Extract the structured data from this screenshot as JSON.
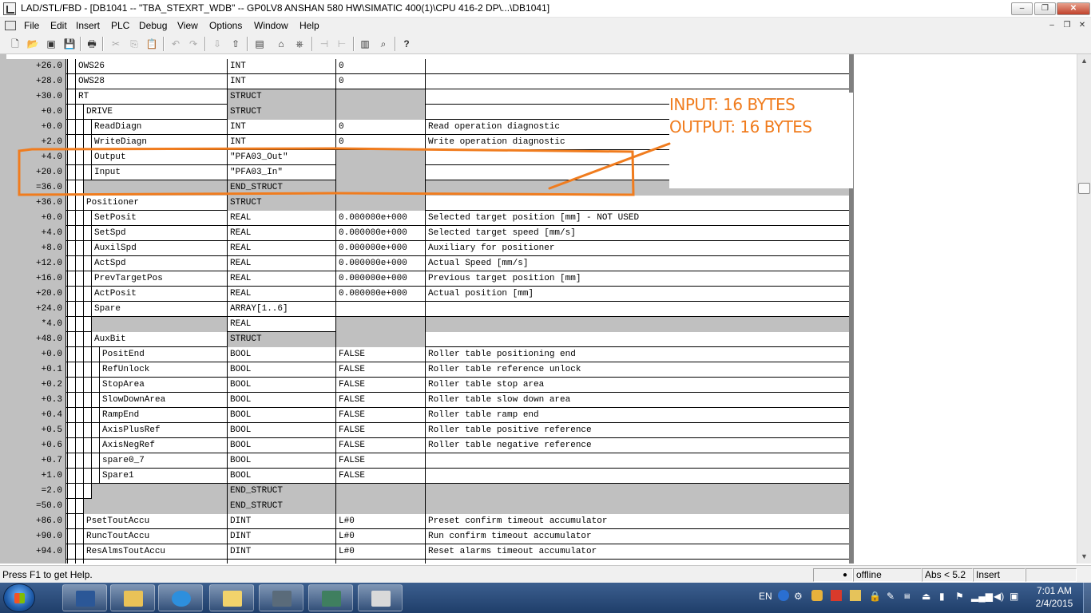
{
  "window": {
    "title": "LAD/STL/FBD  - [DB1041 -- \"TBA_STEXRT_WDB\" -- GP0LV8 ANSHAN 580 HW\\SIMATIC 400(1)\\CPU 416-2 DP\\...\\DB1041]",
    "minimize_glyph": "–",
    "restore_glyph": "❐",
    "close_glyph": "✕"
  },
  "menu": {
    "items": [
      "File",
      "Edit",
      "Insert",
      "PLC",
      "Debug",
      "View",
      "Options",
      "Window",
      "Help"
    ],
    "mdi_minimize": "–",
    "mdi_restore": "❐",
    "mdi_close": "✕"
  },
  "toolbar": {
    "icons": [
      "new-icon",
      "open-icon",
      "accessible-nodes-icon",
      "save-icon",
      "print-icon",
      "cut-icon",
      "copy-icon",
      "paste-icon",
      "undo-icon",
      "redo-icon",
      "load-icon",
      "download-icon",
      "compile-icon",
      "monitor-icon",
      "network-icon",
      "prev-icon",
      "next-icon",
      "overview-icon",
      "details-icon",
      "whats-this-icon"
    ],
    "glyphs": [
      "🗋",
      "📂",
      "▣",
      "💾",
      "🖶",
      "✂",
      "⎘",
      "📋",
      "↶",
      "↷",
      "⇩",
      "⇧",
      "▤",
      "⌂",
      "⎈",
      "⊣",
      "⊢",
      "▥",
      "⌕",
      "?"
    ]
  },
  "table": {
    "rows": [
      {
        "addr": "+26.0",
        "indent": 0,
        "name": "OWS26",
        "type": "INT",
        "init": "0",
        "comment": "",
        "gray_name": false,
        "gray_type": false,
        "gray_init": false,
        "gray_comment": false
      },
      {
        "addr": "+28.0",
        "indent": 0,
        "name": "OWS28",
        "type": "INT",
        "init": "0",
        "comment": "",
        "gray_name": false,
        "gray_type": false,
        "gray_init": false,
        "gray_comment": false
      },
      {
        "addr": "+30.0",
        "indent": 0,
        "name": "RT",
        "type": "STRUCT",
        "init": "",
        "comment": "",
        "gray_name": false,
        "gray_type": true,
        "gray_init": true,
        "gray_comment": false
      },
      {
        "addr": "+0.0",
        "indent": 1,
        "name": "DRIVE",
        "type": "STRUCT",
        "init": "",
        "comment": "",
        "gray_name": false,
        "gray_type": true,
        "gray_init": true,
        "gray_comment": false
      },
      {
        "addr": "+0.0",
        "indent": 2,
        "name": "ReadDiagn",
        "type": "INT",
        "init": "0",
        "comment": "Read operation diagnostic",
        "gray_name": false,
        "gray_type": false,
        "gray_init": false,
        "gray_comment": false
      },
      {
        "addr": "+2.0",
        "indent": 2,
        "name": "WriteDiagn",
        "type": "INT",
        "init": "0",
        "comment": "Write operation diagnostic",
        "gray_name": false,
        "gray_type": false,
        "gray_init": false,
        "gray_comment": false
      },
      {
        "addr": "+4.0",
        "indent": 2,
        "name": "Output",
        "type": "\"PFA03_Out\"",
        "init": "",
        "comment": "",
        "gray_name": false,
        "gray_type": false,
        "gray_init": true,
        "gray_comment": false
      },
      {
        "addr": "+20.0",
        "indent": 2,
        "name": "Input",
        "type": "\"PFA03_In\"",
        "init": "",
        "comment": "",
        "gray_name": false,
        "gray_type": false,
        "gray_init": true,
        "gray_comment": false
      },
      {
        "addr": "=36.0",
        "indent": 1,
        "name": "",
        "type": "END_STRUCT",
        "init": "",
        "comment": "",
        "gray_name": true,
        "gray_type": true,
        "gray_init": true,
        "gray_comment": true
      },
      {
        "addr": "+36.0",
        "indent": 1,
        "name": "Positioner",
        "type": "STRUCT",
        "init": "",
        "comment": "",
        "gray_name": false,
        "gray_type": true,
        "gray_init": true,
        "gray_comment": false
      },
      {
        "addr": "+0.0",
        "indent": 2,
        "name": "SetPosit",
        "type": "REAL",
        "init": "0.000000e+000",
        "comment": "Selected target position [mm] - NOT USED",
        "gray_name": false,
        "gray_type": false,
        "gray_init": false,
        "gray_comment": false
      },
      {
        "addr": "+4.0",
        "indent": 2,
        "name": "SetSpd",
        "type": "REAL",
        "init": "0.000000e+000",
        "comment": "Selected target speed [mm/s]",
        "gray_name": false,
        "gray_type": false,
        "gray_init": false,
        "gray_comment": false
      },
      {
        "addr": "+8.0",
        "indent": 2,
        "name": "AuxilSpd",
        "type": "REAL",
        "init": "0.000000e+000",
        "comment": "Auxiliary for positioner",
        "gray_name": false,
        "gray_type": false,
        "gray_init": false,
        "gray_comment": false
      },
      {
        "addr": "+12.0",
        "indent": 2,
        "name": "ActSpd",
        "type": "REAL",
        "init": "0.000000e+000",
        "comment": "Actual Speed [mm/s]",
        "gray_name": false,
        "gray_type": false,
        "gray_init": false,
        "gray_comment": false
      },
      {
        "addr": "+16.0",
        "indent": 2,
        "name": "PrevTargetPos",
        "type": "REAL",
        "init": "0.000000e+000",
        "comment": "Previous target position [mm]",
        "gray_name": false,
        "gray_type": false,
        "gray_init": false,
        "gray_comment": false
      },
      {
        "addr": "+20.0",
        "indent": 2,
        "name": "ActPosit",
        "type": "REAL",
        "init": "0.000000e+000",
        "comment": "Actual position [mm]",
        "gray_name": false,
        "gray_type": false,
        "gray_init": false,
        "gray_comment": false
      },
      {
        "addr": "+24.0",
        "indent": 2,
        "name": "Spare",
        "type": "ARRAY[1..6]",
        "init": "",
        "comment": "",
        "gray_name": false,
        "gray_type": false,
        "gray_init": false,
        "gray_comment": false
      },
      {
        "addr": "*4.0",
        "indent": 2,
        "name": "",
        "type": "REAL",
        "init": "",
        "comment": "",
        "gray_name": true,
        "gray_type": false,
        "gray_init": true,
        "gray_comment": true
      },
      {
        "addr": "+48.0",
        "indent": 2,
        "name": "AuxBit",
        "type": "STRUCT",
        "init": "",
        "comment": "",
        "gray_name": false,
        "gray_type": true,
        "gray_init": true,
        "gray_comment": false
      },
      {
        "addr": "+0.0",
        "indent": 3,
        "name": "PositEnd",
        "type": "BOOL",
        "init": "FALSE",
        "comment": "Roller table positioning end",
        "gray_name": false,
        "gray_type": false,
        "gray_init": false,
        "gray_comment": false
      },
      {
        "addr": "+0.1",
        "indent": 3,
        "name": "RefUnlock",
        "type": "BOOL",
        "init": "FALSE",
        "comment": "Roller table reference unlock",
        "gray_name": false,
        "gray_type": false,
        "gray_init": false,
        "gray_comment": false
      },
      {
        "addr": "+0.2",
        "indent": 3,
        "name": "StopArea",
        "type": "BOOL",
        "init": "FALSE",
        "comment": "Roller table stop area",
        "gray_name": false,
        "gray_type": false,
        "gray_init": false,
        "gray_comment": false
      },
      {
        "addr": "+0.3",
        "indent": 3,
        "name": "SlowDownArea",
        "type": "BOOL",
        "init": "FALSE",
        "comment": "Roller table slow down area",
        "gray_name": false,
        "gray_type": false,
        "gray_init": false,
        "gray_comment": false
      },
      {
        "addr": "+0.4",
        "indent": 3,
        "name": "RampEnd",
        "type": "BOOL",
        "init": "FALSE",
        "comment": "Roller table ramp end",
        "gray_name": false,
        "gray_type": false,
        "gray_init": false,
        "gray_comment": false
      },
      {
        "addr": "+0.5",
        "indent": 3,
        "name": "AxisPlusRef",
        "type": "BOOL",
        "init": "FALSE",
        "comment": "Roller table positive reference",
        "gray_name": false,
        "gray_type": false,
        "gray_init": false,
        "gray_comment": false
      },
      {
        "addr": "+0.6",
        "indent": 3,
        "name": "AxisNegRef",
        "type": "BOOL",
        "init": "FALSE",
        "comment": "Roller table negative reference",
        "gray_name": false,
        "gray_type": false,
        "gray_init": false,
        "gray_comment": false
      },
      {
        "addr": "+0.7",
        "indent": 3,
        "name": "spare0_7",
        "type": "BOOL",
        "init": "FALSE",
        "comment": "",
        "gray_name": false,
        "gray_type": false,
        "gray_init": false,
        "gray_comment": false
      },
      {
        "addr": "+1.0",
        "indent": 3,
        "name": "Spare1",
        "type": "BOOL",
        "init": "FALSE",
        "comment": "",
        "gray_name": false,
        "gray_type": false,
        "gray_init": false,
        "gray_comment": false
      },
      {
        "addr": "=2.0",
        "indent": 2,
        "name": "",
        "type": "END_STRUCT",
        "init": "",
        "comment": "",
        "gray_name": true,
        "gray_type": true,
        "gray_init": true,
        "gray_comment": true
      },
      {
        "addr": "=50.0",
        "indent": 1,
        "name": "",
        "type": "END_STRUCT",
        "init": "",
        "comment": "",
        "gray_name": true,
        "gray_type": true,
        "gray_init": true,
        "gray_comment": true
      },
      {
        "addr": "+86.0",
        "indent": 1,
        "name": "PsetToutAccu",
        "type": "DINT",
        "init": "L#0",
        "comment": "Preset confirm timeout accumulator",
        "gray_name": false,
        "gray_type": false,
        "gray_init": false,
        "gray_comment": false
      },
      {
        "addr": "+90.0",
        "indent": 1,
        "name": "RuncToutAccu",
        "type": "DINT",
        "init": "L#0",
        "comment": "Run confirm timeout accumulator",
        "gray_name": false,
        "gray_type": false,
        "gray_init": false,
        "gray_comment": false
      },
      {
        "addr": "+94.0",
        "indent": 1,
        "name": "ResAlmsToutAccu",
        "type": "DINT",
        "init": "L#0",
        "comment": "Reset alarms timeout accumulator",
        "gray_name": false,
        "gray_type": false,
        "gray_init": false,
        "gray_comment": false
      },
      {
        "addr": "",
        "indent": 1,
        "name": "",
        "type": "",
        "init": "",
        "comment": "",
        "gray_name": false,
        "gray_type": false,
        "gray_init": false,
        "gray_comment": false
      }
    ]
  },
  "annotation": {
    "line1": "INPUT: 16 BYTES",
    "line2": "OUTPUT: 16 BYTES",
    "color": "#f07c1e"
  },
  "scrollbar": {
    "up_glyph": "▲",
    "down_glyph": "▼"
  },
  "status": {
    "help": "Press F1 to get Help.",
    "mode": "offline",
    "position": "Abs < 5.2",
    "insert": "Insert"
  },
  "taskbar": {
    "apps": [
      "word-icon",
      "explorer-icon",
      "ie-icon",
      "folder-icon",
      "simatic-manager-icon",
      "hw-config-icon",
      "lad-editor-icon"
    ],
    "language": "EN",
    "time": "7:01 AM",
    "date": "2/4/2015"
  },
  "colors": {
    "grid_gray": "#c0c0c0",
    "annotation_orange": "#f07c1e",
    "taskbar_blue": "#2a4b7c"
  }
}
